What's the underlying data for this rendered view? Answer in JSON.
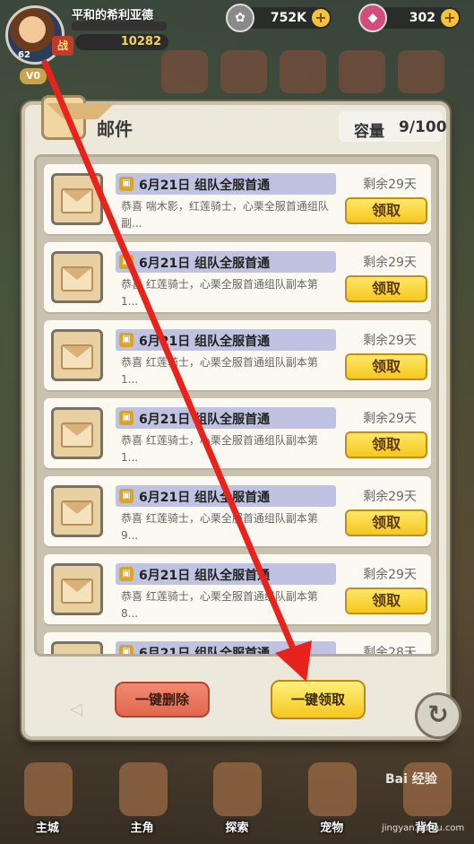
{
  "player": {
    "name": "平和的希利亚德",
    "power": "10282",
    "level": "62",
    "vip": "V0",
    "power_icon": "战"
  },
  "resources": [
    {
      "icon": "paw-icon",
      "value": "752K"
    },
    {
      "icon": "gem-icon",
      "value": "302"
    }
  ],
  "mail_panel": {
    "title": "邮件",
    "capacity_label": "容量",
    "capacity_value": "9/100",
    "claim_label": "领取",
    "delete_all_label": "一键删除",
    "claim_all_label": "一键领取",
    "mails": [
      {
        "title": "6月21日 组队全服首通",
        "body": "恭喜 喘木影，红莲骑士，心栗全服首通组队副...",
        "remaining": "剩余29天"
      },
      {
        "title": "6月21日 组队全服首通",
        "body": "恭喜 红莲骑士，心栗全服首通组队副本第 1...",
        "remaining": "剩余29天"
      },
      {
        "title": "6月21日 组队全服首通",
        "body": "恭喜 红莲骑士，心栗全服首通组队副本第 1...",
        "remaining": "剩余29天"
      },
      {
        "title": "6月21日 组队全服首通",
        "body": "恭喜 红莲骑士，心栗全服首通组队副本第 1...",
        "remaining": "剩余29天"
      },
      {
        "title": "6月21日 组队全服首通",
        "body": "恭喜 红莲骑士，心栗全服首通组队副本第 9...",
        "remaining": "剩余29天"
      },
      {
        "title": "6月21日 组队全服首通",
        "body": "恭喜 红莲骑士，心栗全服首通组队副本第 8...",
        "remaining": "剩余29天"
      },
      {
        "title": "6月21日 组队全服首通",
        "body": "",
        "remaining": "剩余28天"
      }
    ]
  },
  "bottom_nav": [
    {
      "label": "主城"
    },
    {
      "label": "主角"
    },
    {
      "label": "探索"
    },
    {
      "label": "宠物"
    },
    {
      "label": "背包"
    }
  ],
  "watermark": {
    "text": "Bai 经验",
    "url": "jingyan.baidu.com"
  },
  "colors": {
    "accent_yellow": "#f4c71f",
    "delete_red": "#e2664d",
    "annotation_red": "#e8231c"
  }
}
